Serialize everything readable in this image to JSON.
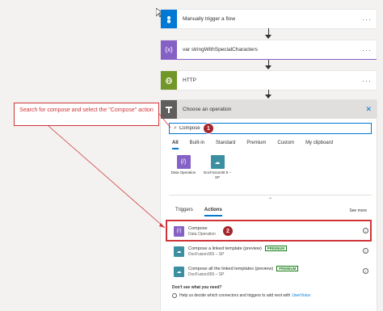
{
  "steps": [
    {
      "title": "Manually trigger a flow",
      "color": "#0078d4",
      "icon": "person-hand-icon"
    },
    {
      "title": "var stringWithSpecialCharacters",
      "color": "#8661c5",
      "icon": "variable-icon"
    },
    {
      "title": "HTTP",
      "color": "#709727",
      "icon": "globe-icon"
    }
  ],
  "operation": {
    "header_title": "Choose an operation",
    "search_value": "Compose",
    "tabs": [
      "All",
      "Built-in",
      "Standard",
      "Premium",
      "Custom",
      "My clipboard"
    ],
    "connectors": [
      {
        "label": "Data Operation",
        "color": "#8661c5"
      },
      {
        "label": "DocFusion36 5 – SP",
        "color": "#3b8fa0"
      }
    ],
    "sub_tabs": [
      "Triggers",
      "Actions"
    ],
    "see_more": "See more",
    "actions": [
      {
        "title": "Compose",
        "sub": "Data Operation",
        "color": "#8661c5",
        "premium": false
      },
      {
        "title": "Compose a linked template (preview)",
        "sub": "DocFusion365 – SP",
        "color": "#3b8fa0",
        "premium": true
      },
      {
        "title": "Compose all the linked templates (preview)",
        "sub": "DocFusion365 – SP",
        "color": "#3b8fa0",
        "premium": true
      }
    ],
    "premium_label": "PREMIUM",
    "help_question": "Don't see what you need?",
    "help_text": "Help us decide which connectors and triggers to add next with",
    "help_link": "UserVoice"
  },
  "annotation": {
    "text": "Search for compose and select the \"Compose\" action"
  },
  "badges": {
    "one": "1",
    "two": "2"
  },
  "colors": {
    "accent": "#0078d4",
    "annotation_red": "#d13438"
  }
}
